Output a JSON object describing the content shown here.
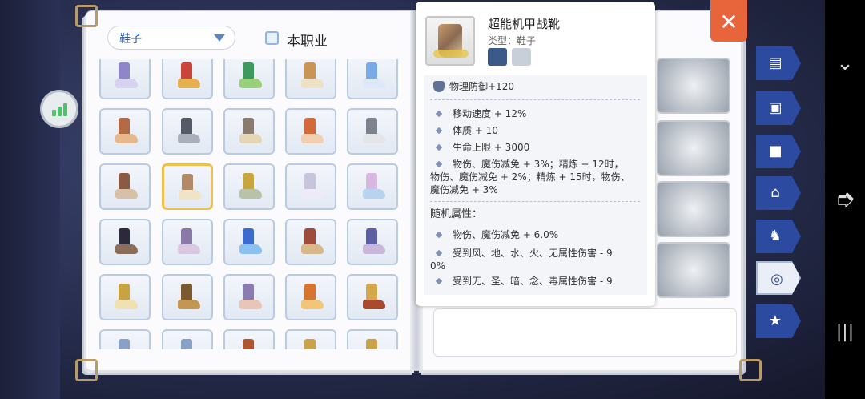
{
  "filter": {
    "category_value": "鞋子",
    "class_only_label": "本职业",
    "class_only_checked": false
  },
  "item": {
    "name": "超能机甲战靴",
    "type_line": "类型：鞋子",
    "base_stat": "物理防御+120",
    "effects": [
      "移动速度 + 12%",
      "体质 + 10",
      "生命上限 + 3000",
      "物伤、魔伤减免 + 3%；精炼 + 12时，",
      "物伤、魔伤减免 + 2%；精炼 + 15时，物伤、",
      "魔伤减免 + 3%"
    ],
    "random_title": "随机属性：",
    "random_effects": [
      "物伤、魔伤减免 + 6.0%",
      "受到风、地、水、火、无属性伤害 - 9.",
      "0%",
      "受到无、圣、暗、念、毒属性伤害 - 9."
    ]
  },
  "side_tabs": [
    {
      "name": "book-tab-icon",
      "glyph": "▤"
    },
    {
      "name": "card-tab-icon",
      "glyph": "▣"
    },
    {
      "name": "bag-tab-icon",
      "glyph": "■"
    },
    {
      "name": "chair-tab-icon",
      "glyph": "⌂"
    },
    {
      "name": "horse-tab-icon",
      "glyph": "♞"
    },
    {
      "name": "emblem-tab-icon",
      "glyph": "◎"
    },
    {
      "name": "medal-tab-icon",
      "glyph": "★"
    }
  ],
  "close_glyph": "✕",
  "colors": {
    "accent_orange": "#e8643a",
    "tab_blue": "#2c4a9f",
    "selected_gold": "#f1c04c"
  }
}
